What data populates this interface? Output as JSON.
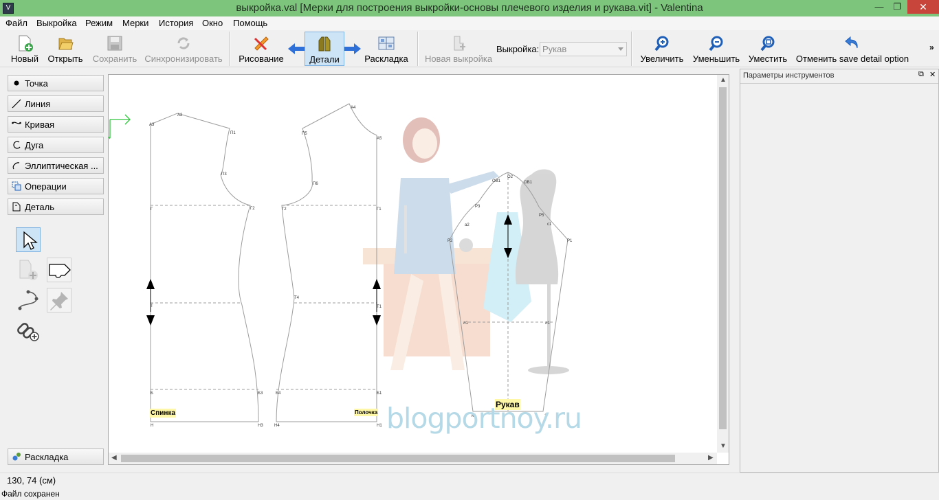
{
  "window": {
    "title": "выкройка.val [Мерки для построения выкройки-основы плечевого изделия и рукава.vit] - Valentina",
    "app_icon": "valentina-app-icon",
    "controls": {
      "minimize": "—",
      "maximize": "❐",
      "close": "✕"
    }
  },
  "menu": [
    "Файл",
    "Выкройка",
    "Режим",
    "Мерки",
    "История",
    "Окно",
    "Помощь"
  ],
  "toolbar": {
    "new": "Новый",
    "open": "Открыть",
    "save": "Сохранить",
    "sync": "Синхронизировать",
    "draw": "Рисование",
    "details": "Детали",
    "layout": "Раскладка",
    "new_pattern": "Новая выкройка",
    "pattern_label": "Выкройка:",
    "pattern_value": "Рукав",
    "zoom_in": "Увеличить",
    "zoom_out": "Уменьшить",
    "fit": "Уместить",
    "undo": "Отменить save detail option",
    "more": "»"
  },
  "tools": {
    "point": "Точка",
    "line": "Линия",
    "curve": "Кривая",
    "arc": "Дуга",
    "elliptical": "Эллиптическая ...",
    "operations": "Операции",
    "detail": "Деталь",
    "layout": "Раскладка"
  },
  "canvas": {
    "detail_back": "Спинка",
    "detail_front": "Полочка",
    "detail_sleeve": "Рукав",
    "watermark": "blogportnoy.ru",
    "points_back": [
      "А3",
      "А2",
      "П1",
      "П3",
      "Г",
      "Г2",
      "Т",
      "Б",
      "Б3",
      "Н",
      "Н3"
    ],
    "points_front": [
      "А4",
      "П5",
      "А5",
      "П6",
      "Г2",
      "Г1",
      "Т4",
      "Т1",
      "Б4",
      "Б1",
      "Н4",
      "Н1"
    ],
    "points_sleeve": [
      "О2",
      "ОВ1",
      "ОВ1",
      "Р3",
      "Р5",
      "а2",
      "с1",
      "Р2",
      "Р1",
      "л1",
      "л1",
      "К1",
      "1"
    ]
  },
  "dock": {
    "title": "Параметры инструментов",
    "float": "⧉",
    "close": "✕"
  },
  "status": {
    "coords": "130, 74 (см)",
    "message": "Файл сохранен"
  }
}
